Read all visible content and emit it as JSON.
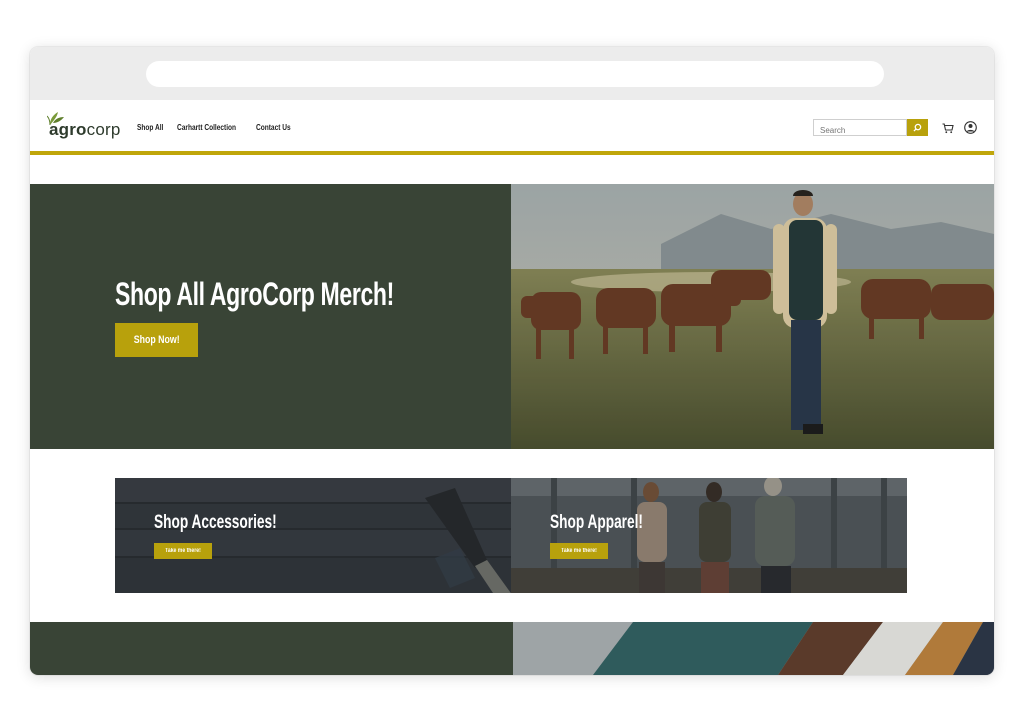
{
  "brand": {
    "logo_strong": "agro",
    "logo_light": "corp",
    "accent_color": "#c0a60a",
    "dark_green": "#394436"
  },
  "nav": {
    "items": [
      {
        "label": "Shop All"
      },
      {
        "label": "Carhartt Collection"
      },
      {
        "label": "Contact Us"
      }
    ]
  },
  "search": {
    "placeholder": "Search",
    "button_icon": "search-icon"
  },
  "header_icons": [
    "cart-icon",
    "user-account-icon"
  ],
  "hero": {
    "title": "Shop All AgroCorp Merch!",
    "button_label": "Shop Now!",
    "image": "farmer-walking-with-cattle-photo"
  },
  "promos": [
    {
      "title": "Shop Accessories!",
      "button_label": "Take me there!",
      "image": "garden-tools-on-wood-photo"
    },
    {
      "title": "Shop Apparel!",
      "button_label": "Take me there!",
      "image": "farmers-in-barn-photo"
    }
  ],
  "bottom_section": {
    "image": "fabric-swatches-photo"
  }
}
